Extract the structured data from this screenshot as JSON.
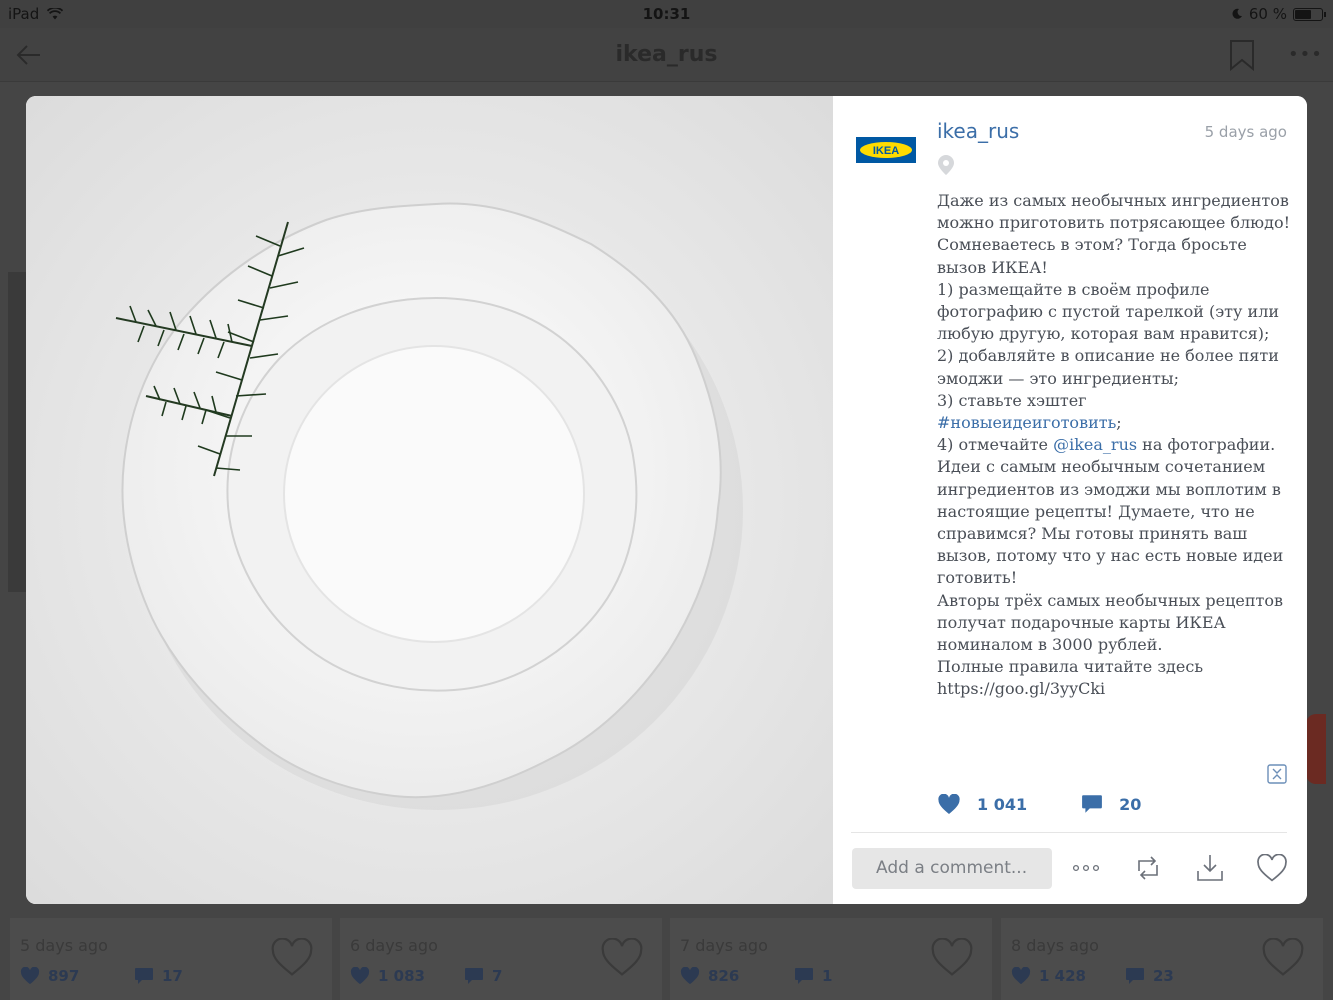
{
  "status_bar": {
    "device": "iPad",
    "time": "10:31",
    "battery_text": "60 %",
    "icons": [
      "wifi-icon",
      "moon-icon",
      "battery-icon"
    ]
  },
  "nav": {
    "title": "ikea_rus",
    "icons": [
      "back-arrow-icon",
      "bookmark-icon",
      "more-icon"
    ]
  },
  "background_cards": [
    {
      "ago": "5 days ago",
      "likes": "897",
      "comments": "17"
    },
    {
      "ago": "6 days ago",
      "likes": "1 083",
      "comments": "7"
    },
    {
      "ago": "7 days ago",
      "likes": "826",
      "comments": "1"
    },
    {
      "ago": "8 days ago",
      "likes": "1 428",
      "comments": "23"
    }
  ],
  "post": {
    "username": "ikea_rus",
    "logo_text": "IKEA",
    "time_ago": "5 days ago",
    "caption_parts": {
      "p1": "Даже из самых необычных ингредиентов можно приготовить потрясающее блюдо!\nСомневаетесь в этом? Тогда бросьте вызов ИКЕА!\n1) размещайте в своём профиле фотографию с пустой тарелкой (эту или любую другую, которая вам нравится);\n2) добавляйте в описание не более пяти эмоджи — это ингредиенты;\n3) ставьте хэштег\n",
      "hashtag": "#новыеидеиготовить",
      "p2": ";\n4) отмечайте ",
      "mention": "@ikea_rus",
      "p3": " на фотографии.\nИдеи с самым необычным сочетанием ингредиентов из эмоджи мы воплотим в настоящие рецепты! Думаете, что не справимся? Мы готовы принять ваш вызов, потому что у нас есть новые идеи готовить!\nАвторы трёх самых необычных рецептов получат подарочные карты ИКЕА номиналом в 3000 рублей.\nПолные правила читайте здесь https://goo.gl/3yyCki"
    },
    "likes": "1 041",
    "comments": "20",
    "comment_placeholder": "Add a comment...",
    "colors": {
      "accent": "#3b6ea8",
      "ikea_blue": "#0058a3",
      "ikea_yellow": "#ffdb00"
    }
  }
}
